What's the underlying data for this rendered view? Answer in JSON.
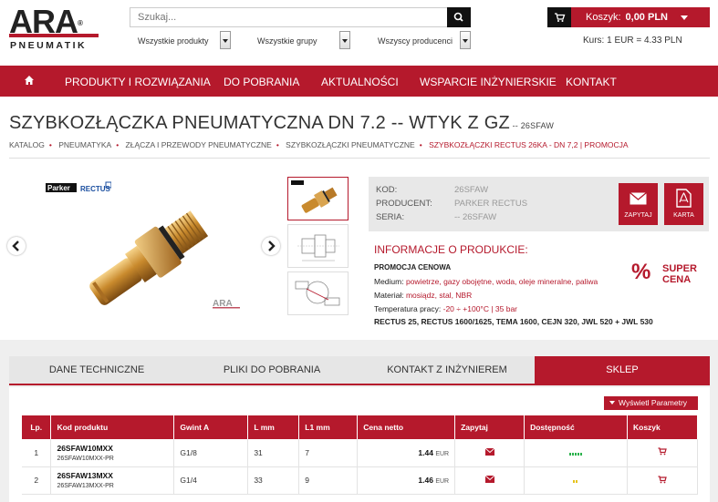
{
  "brand": {
    "name": "ARA",
    "sub": "PNEUMATIK",
    "reg": "®"
  },
  "search": {
    "placeholder": "Szukaj..."
  },
  "filters": [
    {
      "label": "Wszystkie produkty"
    },
    {
      "label": "Wszystkie grupy"
    },
    {
      "label": "Wszyscy producenci"
    }
  ],
  "cart": {
    "label": "Koszyk:",
    "value": "0,00 PLN"
  },
  "rate": "Kurs: 1 EUR = 4.33 PLN",
  "nav": [
    "PRODUKTY I ROZWIĄZANIA",
    "DO POBRANIA",
    "AKTUALNOŚCI",
    "WSPARCIE INŻYNIERSKIE",
    "KONTAKT"
  ],
  "title": {
    "main": "SZYBKOZŁĄCZKA PNEUMATYCZNA DN 7.2 -- WTYK Z GZ",
    "code": " -- 26SFAW"
  },
  "breadcrumb": [
    "KATALOG",
    "PNEUMATYKA",
    "ZŁĄCZA I PRZEWODY PNEUMATYCZNE",
    "SZYBKOZŁĄCZKI PNEUMATYCZNE",
    "SZYBKOZŁĄCZKI RECTUS 26KA - DN 7,2 | PROMOCJA"
  ],
  "gallery": {
    "brand_left": "Parker",
    "brand_right": "RECTUS",
    "watermark": "ARA"
  },
  "details": {
    "rows": [
      {
        "label": "KOD:",
        "value": "26SFAW"
      },
      {
        "label": "PRODUCENT:",
        "value": "PARKER RECTUS"
      },
      {
        "label": "SERIA:",
        "value": "-- 26SFAW"
      }
    ],
    "ask_label": "ZAPYTAJ",
    "card_label": "KARTA"
  },
  "info": {
    "heading": "INFORMACJE O PRODUKCIE:",
    "promo": "PROMOCJA CENOWA",
    "specs": [
      {
        "label": "Medium:",
        "value": "powietrze, gazy obojętne, woda, oleje mineralne, paliwa"
      },
      {
        "label": "Materiał:",
        "value": "mosiądz, stal, NBR"
      },
      {
        "label": "Temperatura pracy:",
        "value": "-20 ÷ +100°C | 35 bar"
      }
    ],
    "compat": "RECTUS 25, RECTUS 1600/1625, TEMA 1600, CEJN 320, JWL 520 + JWL 530",
    "super_line1": "SUPER",
    "super_line2": "CENA",
    "pct": "%"
  },
  "tabs": [
    "DANE TECHNICZNE",
    "PLIKI DO POBRANIA",
    "KONTAKT Z INŻYNIEREM",
    "SKLEP"
  ],
  "params_button": "Wyświetl Parametry",
  "table": {
    "headers": [
      "Lp.",
      "Kod produktu",
      "Gwint A",
      "L mm",
      "L1 mm",
      "Cena netto",
      "Zapytaj",
      "Dostępność",
      "Koszyk"
    ],
    "rows": [
      {
        "lp": "1",
        "code": "26SFAW10MXX",
        "sub": "26SFAW10MXX-PR",
        "thread": "G1/8",
        "l": "31",
        "l1": "7",
        "price": "1.44",
        "currency": "EUR",
        "availability": 5
      },
      {
        "lp": "2",
        "code": "26SFAW13MXX",
        "sub": "26SFAW13MXX-PR",
        "thread": "G1/4",
        "l": "33",
        "l1": "9",
        "price": "1.46",
        "currency": "EUR",
        "availability": 2
      }
    ]
  },
  "colors": {
    "brand_red": "#b5192c",
    "avail_green": "#2bb24c",
    "avail_yellow": "#e6c21a"
  }
}
